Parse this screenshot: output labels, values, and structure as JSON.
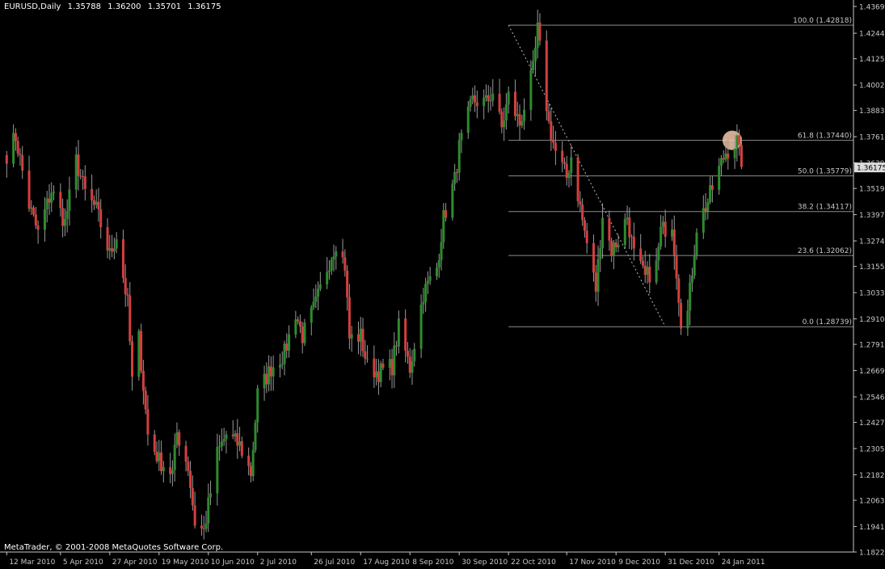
{
  "window": {
    "symbol": "EURUSD,Daily",
    "open": "1.35788",
    "high": "1.36200",
    "low": "1.35701",
    "close": "1.36175",
    "copyright": "MetaTrader, © 2001-2008 MetaQuotes Software Corp."
  },
  "colors": {
    "background": "#000000",
    "bull": "#2e8b2e",
    "bear": "#d43f3f",
    "wick": "#9a9a9a",
    "axis": "#c8c8c8",
    "fib": "#8c8c8c",
    "price_label_bg": "#dcdcdc",
    "highlight": "#f7c8a8"
  },
  "chart_data": {
    "type": "candlestick",
    "symbol": "EURUSD",
    "timeframe": "Daily",
    "ylim": [
      1.1822,
      1.4369
    ],
    "y_ticks": [
      "1.43690",
      "1.42440",
      "1.41250",
      "1.40025",
      "1.38835",
      "1.37610",
      "1.36390",
      "1.35195",
      "1.33970",
      "1.32745",
      "1.31555",
      "1.30330",
      "1.29105",
      "1.27915",
      "1.26690",
      "1.25465",
      "1.24275",
      "1.23050",
      "1.21825",
      "1.20635",
      "1.19410",
      "1.18220"
    ],
    "x_ticks": [
      "12 Mar 2010",
      "5 Apr 2010",
      "27 Apr 2010",
      "19 May 2010",
      "10 Jun 2010",
      "2 Jul 2010",
      "26 Jul 2010",
      "17 Aug 2010",
      "8 Sep 2010",
      "30 Sep 2010",
      "22 Oct 2010",
      "17 Nov 2010",
      "9 Dec 2010",
      "31 Dec 2010",
      "24 Jan 2011"
    ],
    "current_price": "1.36175",
    "fibonacci": [
      {
        "label": "100.0 (1.42818)",
        "price": 1.42818
      },
      {
        "label": "61.8 (1.37440)",
        "price": 1.3744
      },
      {
        "label": "50.0 (1.35779)",
        "price": 1.35779
      },
      {
        "label": "38.2 (1.34117)",
        "price": 1.34117
      },
      {
        "label": "23.6 (1.32062)",
        "price": 1.32062
      },
      {
        "label": "0.0 (1.28739)",
        "price": 1.28739
      }
    ],
    "fib_start_date": "22 Oct 2010",
    "fib_end_date": "31 Dec 2010",
    "anchors": [
      {
        "date": "12 Mar 2010",
        "close": 1.368
      },
      {
        "date": "16 Mar 2010",
        "close": 1.376
      },
      {
        "date": "22 Mar 2010",
        "close": 1.344
      },
      {
        "date": "26 Mar 2010",
        "close": 1.331
      },
      {
        "date": "1 Apr 2010",
        "close": 1.351
      },
      {
        "date": "7 Apr 2010",
        "close": 1.336
      },
      {
        "date": "12 Apr 2010",
        "close": 1.365
      },
      {
        "date": "16 Apr 2010",
        "close": 1.35
      },
      {
        "date": "21 Apr 2010",
        "close": 1.342
      },
      {
        "date": "27 Apr 2010",
        "close": 1.321
      },
      {
        "date": "30 Apr 2010",
        "close": 1.33
      },
      {
        "date": "5 May 2010",
        "close": 1.298
      },
      {
        "date": "7 May 2010",
        "close": 1.262
      },
      {
        "date": "10 May 2010",
        "close": 1.282
      },
      {
        "date": "14 May 2010",
        "close": 1.237
      },
      {
        "date": "19 May 2010",
        "close": 1.225
      },
      {
        "date": "25 May 2010",
        "close": 1.219
      },
      {
        "date": "27 May 2010",
        "close": 1.238
      },
      {
        "date": "1 Jun 2010",
        "close": 1.222
      },
      {
        "date": "4 Jun 2010",
        "close": 1.196
      },
      {
        "date": "8 Jun 2010",
        "close": 1.192
      },
      {
        "date": "14 Jun 2010",
        "close": 1.228
      },
      {
        "date": "18 Jun 2010",
        "close": 1.237
      },
      {
        "date": "24 Jun 2010",
        "close": 1.232
      },
      {
        "date": "29 Jun 2010",
        "close": 1.219
      },
      {
        "date": "2 Jul 2010",
        "close": 1.256
      },
      {
        "date": "8 Jul 2010",
        "close": 1.268
      },
      {
        "date": "14 Jul 2010",
        "close": 1.275
      },
      {
        "date": "19 Jul 2010",
        "close": 1.294
      },
      {
        "date": "22 Jul 2010",
        "close": 1.283
      },
      {
        "date": "28 Jul 2010",
        "close": 1.298
      },
      {
        "date": "2 Aug 2010",
        "close": 1.315
      },
      {
        "date": "6 Aug 2010",
        "close": 1.327
      },
      {
        "date": "10 Aug 2010",
        "close": 1.316
      },
      {
        "date": "12 Aug 2010",
        "close": 1.282
      },
      {
        "date": "17 Aug 2010",
        "close": 1.283
      },
      {
        "date": "20 Aug 2010",
        "close": 1.269
      },
      {
        "date": "25 Aug 2010",
        "close": 1.266
      },
      {
        "date": "31 Aug 2010",
        "close": 1.269
      },
      {
        "date": "3 Sep 2010",
        "close": 1.287
      },
      {
        "date": "8 Sep 2010",
        "close": 1.268
      },
      {
        "date": "14 Sep 2010",
        "close": 1.303
      },
      {
        "date": "20 Sep 2010",
        "close": 1.315
      },
      {
        "date": "23 Sep 2010",
        "close": 1.338
      },
      {
        "date": "28 Sep 2010",
        "close": 1.356
      },
      {
        "date": "30 Sep 2010",
        "close": 1.371
      },
      {
        "date": "6 Oct 2010",
        "close": 1.393
      },
      {
        "date": "12 Oct 2010",
        "close": 1.392
      },
      {
        "date": "15 Oct 2010",
        "close": 1.397
      },
      {
        "date": "19 Oct 2010",
        "close": 1.38
      },
      {
        "date": "22 Oct 2010",
        "close": 1.395
      },
      {
        "date": "27 Oct 2010",
        "close": 1.382
      },
      {
        "date": "2 Nov 2010",
        "close": 1.407
      },
      {
        "date": "4 Nov 2010",
        "close": 1.426
      },
      {
        "date": "9 Nov 2010",
        "close": 1.382
      },
      {
        "date": "12 Nov 2010",
        "close": 1.369
      },
      {
        "date": "17 Nov 2010",
        "close": 1.357
      },
      {
        "date": "19 Nov 2010",
        "close": 1.367
      },
      {
        "date": "24 Nov 2010",
        "close": 1.337
      },
      {
        "date": "30 Nov 2010",
        "close": 1.305
      },
      {
        "date": "3 Dec 2010",
        "close": 1.34
      },
      {
        "date": "7 Dec 2010",
        "close": 1.323
      },
      {
        "date": "10 Dec 2010",
        "close": 1.328
      },
      {
        "date": "14 Dec 2010",
        "close": 1.339
      },
      {
        "date": "17 Dec 2010",
        "close": 1.321
      },
      {
        "date": "22 Dec 2010",
        "close": 1.31
      },
      {
        "date": "27 Dec 2010",
        "close": 1.316
      },
      {
        "date": "29 Dec 2010",
        "close": 1.332
      },
      {
        "date": "3 Jan 2011",
        "close": 1.336
      },
      {
        "date": "7 Jan 2011",
        "close": 1.291
      },
      {
        "date": "10 Jan 2011",
        "close": 1.294
      },
      {
        "date": "14 Jan 2011",
        "close": 1.334
      },
      {
        "date": "19 Jan 2011",
        "close": 1.346
      },
      {
        "date": "24 Jan 2011",
        "close": 1.361
      },
      {
        "date": "27 Jan 2011",
        "close": 1.369
      },
      {
        "date": "1 Feb 2011",
        "close": 1.374
      },
      {
        "date": "3 Feb 2011",
        "close": 1.362
      }
    ]
  }
}
